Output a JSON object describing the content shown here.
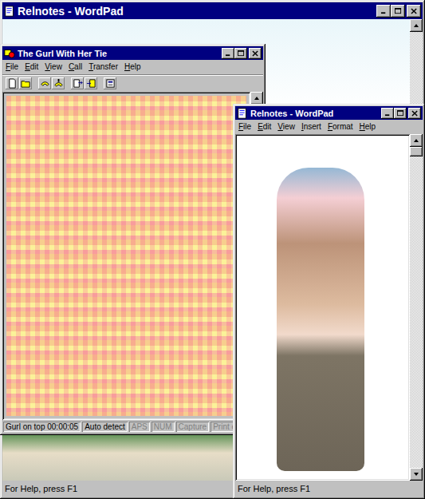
{
  "background_window": {
    "title": "Relnotes - WordPad",
    "status_bar": "For Help, press F1"
  },
  "terminal_window": {
    "title": "The Gurl With Her Tie",
    "menu": [
      "File",
      "Edit",
      "View",
      "Call",
      "Transfer",
      "Help"
    ],
    "status_bar": [
      {
        "text": "Gurl on top 00:00:05",
        "disabled": false
      },
      {
        "text": "Auto detect",
        "disabled": false
      },
      {
        "text": "APS",
        "disabled": true
      },
      {
        "text": "NUM",
        "disabled": true
      },
      {
        "text": "Capture",
        "disabled": true
      },
      {
        "text": "Print ec",
        "disabled": true
      }
    ]
  },
  "front_window": {
    "title": "Relnotes - WordPad",
    "menu": [
      "File",
      "Edit",
      "View",
      "Insert",
      "Format",
      "Help"
    ],
    "scrollbar": {
      "level": 0
    },
    "status_bar": "For Help, press F1"
  }
}
